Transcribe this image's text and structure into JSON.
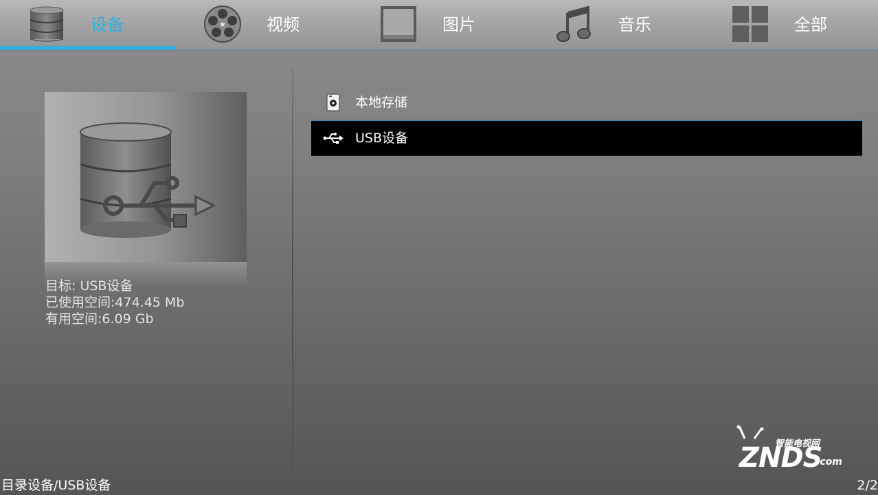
{
  "tabs": [
    {
      "label": "设备",
      "icon": "database-icon",
      "active": true
    },
    {
      "label": "视频",
      "icon": "film-reel-icon",
      "active": false
    },
    {
      "label": "图片",
      "icon": "picture-frame-icon",
      "active": false
    },
    {
      "label": "音乐",
      "icon": "music-note-icon",
      "active": false
    },
    {
      "label": "全部",
      "icon": "grid-icon",
      "active": false
    }
  ],
  "info": {
    "target": "目标: USB设备",
    "used": "已使用空间:474.45 Mb",
    "free": "有用空间:6.09 Gb"
  },
  "list": {
    "items": [
      {
        "label": "本地存储",
        "icon": "local-storage-icon",
        "selected": false
      },
      {
        "label": "USB设备",
        "icon": "usb-icon",
        "selected": true
      }
    ]
  },
  "footer": {
    "path": "目录设备/USB设备",
    "page": "2/2"
  },
  "watermark": {
    "top_text": "智能电视网",
    "main_text": "ZNDS",
    "suffix": ".com"
  },
  "colors": {
    "accent": "#31b0e0",
    "selected_row": "#000000"
  }
}
